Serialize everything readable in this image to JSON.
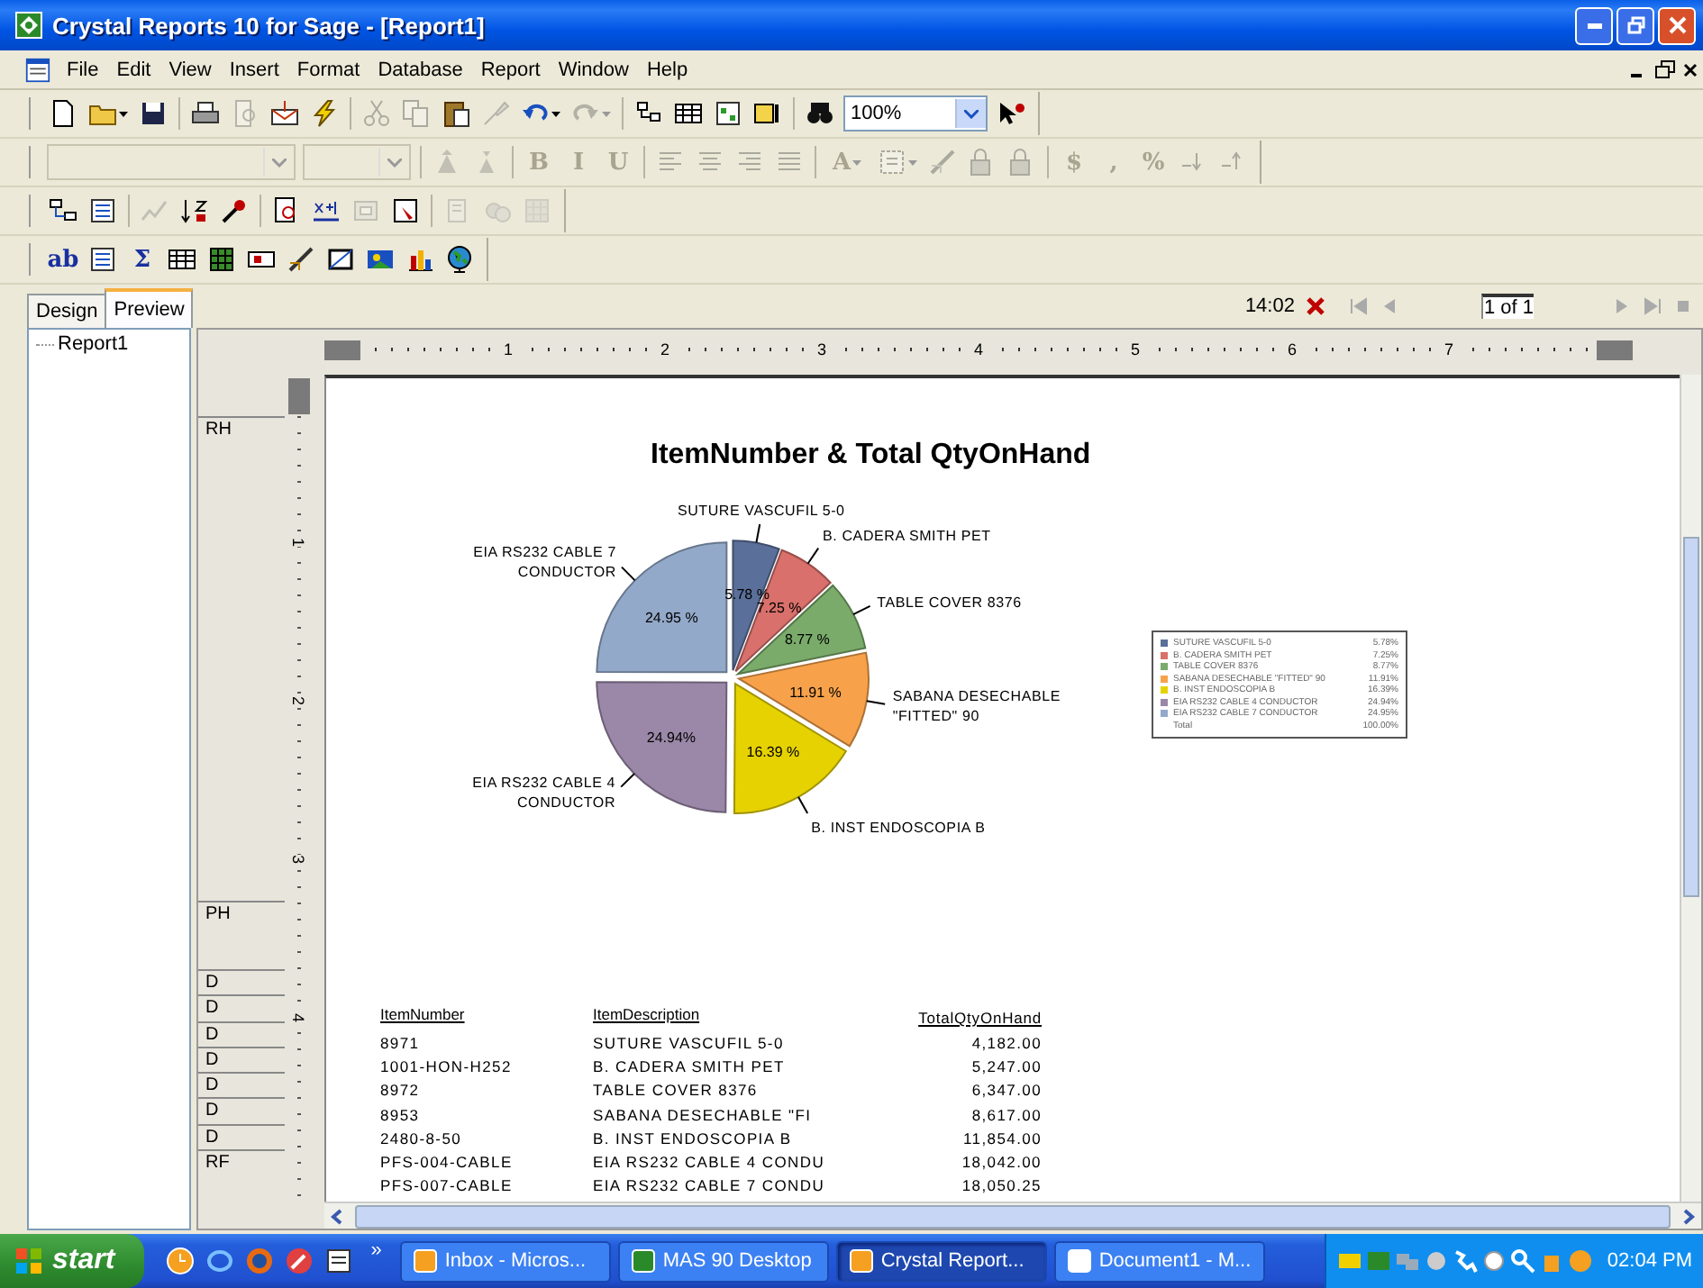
{
  "window": {
    "title": "Crystal Reports 10 for Sage - [Report1]"
  },
  "menu": [
    "File",
    "Edit",
    "View",
    "Insert",
    "Format",
    "Database",
    "Report",
    "Window",
    "Help"
  ],
  "toolbars": [
    {
      "zoom": {
        "value": "100%"
      },
      "buttons": [
        {
          "disabled": false
        },
        {
          "disabled": false
        },
        {
          "disabled": false
        },
        {
          "disabled": false
        },
        {
          "disabled": true
        },
        {
          "disabled": false
        },
        {
          "disabled": false
        },
        {
          "disabled": true
        },
        {
          "disabled": true
        },
        {
          "disabled": false
        },
        {
          "disabled": true
        },
        {
          "disabled": false
        },
        {
          "disabled": true
        },
        {
          "disabled": false
        },
        {
          "disabled": false
        },
        {
          "disabled": false
        },
        {
          "disabled": false
        },
        {
          "disabled": false
        },
        {
          "disabled": false
        }
      ]
    },
    {
      "buttons": [
        {
          "disabled": true
        },
        {
          "disabled": true
        },
        {
          "disabled": true,
          "glyph": "B"
        },
        {
          "disabled": true,
          "glyph": "I"
        },
        {
          "disabled": true,
          "glyph": "U"
        },
        {
          "disabled": true
        },
        {
          "disabled": true
        },
        {
          "disabled": true
        },
        {
          "disabled": true
        },
        {
          "disabled": true,
          "glyph": "A"
        },
        {
          "disabled": true
        },
        {
          "disabled": true
        },
        {
          "disabled": true
        },
        {
          "disabled": true
        },
        {
          "disabled": true,
          "glyph": "$"
        },
        {
          "disabled": true,
          "glyph": ","
        },
        {
          "disabled": true,
          "glyph": "%"
        },
        {
          "disabled": true
        },
        {
          "disabled": true
        }
      ]
    },
    {
      "buttons": [
        {
          "disabled": false
        },
        {
          "disabled": false
        },
        {
          "disabled": true
        },
        {
          "disabled": false
        },
        {
          "disabled": false
        },
        {
          "disabled": false
        },
        {
          "disabled": false
        },
        {
          "disabled": true
        },
        {
          "disabled": false
        },
        {
          "disabled": true
        },
        {
          "disabled": true
        },
        {
          "disabled": true
        }
      ]
    },
    {
      "buttons": [
        {
          "disabled": false,
          "glyph": "ab"
        },
        {
          "disabled": false
        },
        {
          "disabled": false,
          "glyph": "Σ"
        },
        {
          "disabled": false
        },
        {
          "disabled": false
        },
        {
          "disabled": false
        },
        {
          "disabled": false
        },
        {
          "disabled": false
        },
        {
          "disabled": false
        },
        {
          "disabled": false
        },
        {
          "disabled": false
        }
      ]
    }
  ],
  "tabs": [
    {
      "label": "Design",
      "selected": false
    },
    {
      "label": "Preview",
      "selected": true
    }
  ],
  "preview_nav": {
    "time": "14:02",
    "page": "1 of 1"
  },
  "tree": {
    "items": [
      {
        "label": "Report1"
      }
    ]
  },
  "ruler": {
    "labels": [
      "1",
      "2",
      "3",
      "4",
      "5",
      "6",
      "7"
    ]
  },
  "vertical_ruler": {
    "labels": [
      "1",
      "2",
      "3",
      "4"
    ]
  },
  "sections": {
    "report_header": "RH",
    "page_header": "PH",
    "details": [
      "D",
      "D",
      "D",
      "D",
      "D",
      "D",
      "D"
    ],
    "report_footer": "RF"
  },
  "report": {
    "chart_data": {
      "type": "pie",
      "title": "ItemNumber & Total QtyOnHand",
      "categories": [
        "SUTURE VASCUFIL 5-0",
        "B. CADERA SMITH PET",
        "TABLE COVER 8376",
        "SABANA DESECHABLE \"FITTED\"  90",
        "B. INST ENDOSCOPIA B",
        "EIA RS232 CABLE 4 CONDUCTOR",
        "EIA RS232 CABLE 7 CONDUCTOR"
      ],
      "values": [
        5.78,
        7.25,
        8.77,
        11.91,
        16.39,
        24.94,
        24.95
      ],
      "value_labels": [
        "5.78 %",
        "7.25 %",
        "8.77 %",
        "11.91 %",
        "16.39 %",
        "24.94%",
        "24.95 %"
      ]
    },
    "legend": {
      "items": [
        {
          "label": "SUTURE VASCUFIL 5-0",
          "value": "5.78%",
          "color": "#5a6f99"
        },
        {
          "label": "B. CADERA SMITH PET",
          "value": "7.25%",
          "color": "#d9706b"
        },
        {
          "label": "TABLE COVER 8376",
          "value": "8.77%",
          "color": "#7aab6a"
        },
        {
          "label": "SABANA DESECHABLE \"FITTED\" 90",
          "value": "11.91%",
          "color": "#f7a24a"
        },
        {
          "label": "B. INST ENDOSCOPIA B",
          "value": "16.39%",
          "color": "#e6d200"
        },
        {
          "label": "EIA RS232 CABLE 4 CONDUCTOR",
          "value": "24.94%",
          "color": "#9b88a8"
        },
        {
          "label": "EIA RS232 CABLE 7 CONDUCTOR",
          "value": "24.95%",
          "color": "#93a9c9"
        }
      ],
      "total_label": "Total",
      "total_value": "100.00%"
    },
    "table": {
      "columns": [
        "ItemNumber",
        "ItemDescription",
        "TotalQtyOnHand"
      ],
      "rows": [
        [
          "8971",
          "SUTURE VASCUFIL 5-0",
          "4,182.00"
        ],
        [
          "1001-HON-H252",
          "B. CADERA SMITH PET",
          "5,247.00"
        ],
        [
          "8972",
          "TABLE COVER 8376",
          "6,347.00"
        ],
        [
          "8953",
          "SABANA DESECHABLE \"FI",
          "8,617.00"
        ],
        [
          "2480-8-50",
          "B. INST ENDOSCOPIA B",
          "11,854.00"
        ],
        [
          "PFS-004-CABLE",
          "EIA RS232 CABLE 4 CONDU",
          "18,042.00"
        ],
        [
          "PFS-007-CABLE",
          "EIA RS232 CABLE 7 CONDU",
          "18,050.25"
        ]
      ]
    }
  },
  "taskbar": {
    "start": "start",
    "chevron": "»",
    "tasks": [
      {
        "label": "Inbox - Micros...",
        "selected": false
      },
      {
        "label": "MAS 90 Desktop",
        "selected": false
      },
      {
        "label": "Crystal Report...",
        "selected": true
      },
      {
        "label": "Document1 - M...",
        "selected": false
      }
    ],
    "clock": "02:04 PM"
  }
}
